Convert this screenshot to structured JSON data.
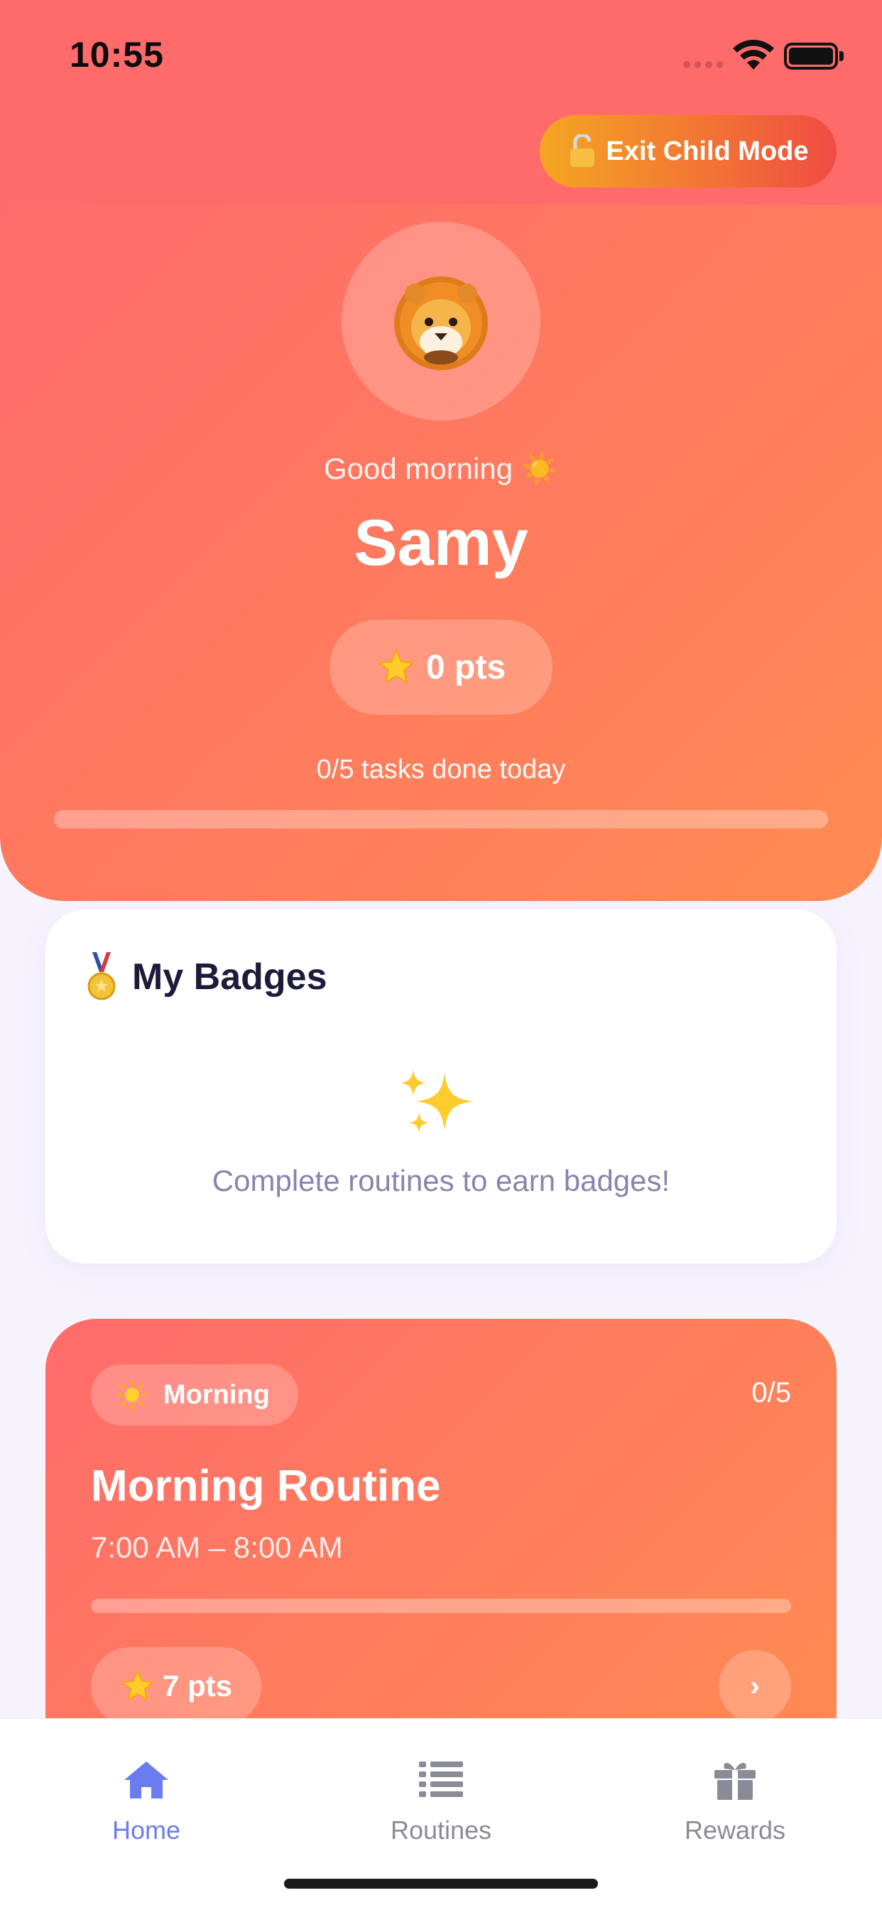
{
  "status_bar": {
    "time": "10:55"
  },
  "header": {
    "exit_label": "Exit Child Mode"
  },
  "profile": {
    "avatar": "lion-emoji",
    "greeting": "Good morning ☀️",
    "name": "Samy",
    "points_label": "0 pts",
    "tasks_summary": "0/5 tasks done today",
    "tasks_progress": 0
  },
  "badges": {
    "title": "My Badges",
    "empty_text": "Complete routines to earn badges!"
  },
  "routine": {
    "period": "Morning",
    "count": "0/5",
    "title": "Morning Routine",
    "time_range": "7:00 AM – 8:00 AM",
    "progress": 0,
    "points_label": "7 pts",
    "chevron": "›"
  },
  "tabs": [
    {
      "label": "Home",
      "icon": "home-icon",
      "active": true
    },
    {
      "label": "Routines",
      "icon": "list-icon",
      "active": false
    },
    {
      "label": "Rewards",
      "icon": "gift-icon",
      "active": false
    }
  ],
  "colors": {
    "accent_start": "#ff6b6b",
    "accent_end": "#ff8b52",
    "tab_active": "#6a7cf0",
    "tab_inactive": "#8b8b98"
  }
}
